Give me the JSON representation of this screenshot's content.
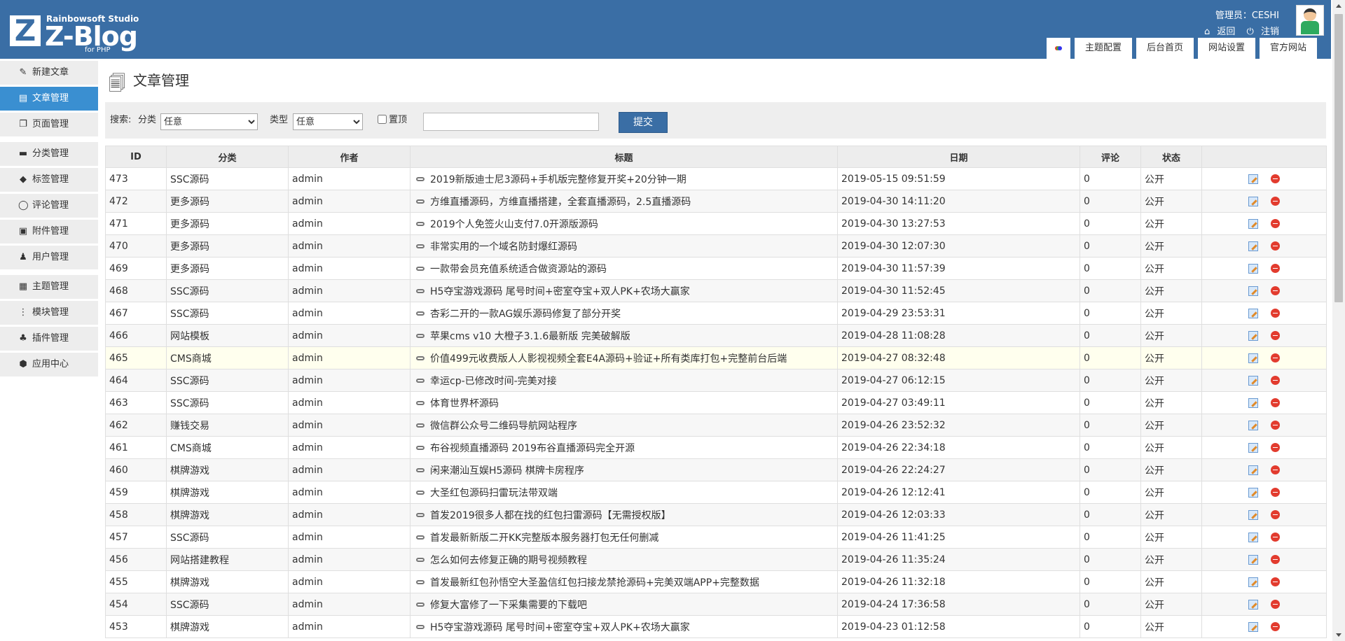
{
  "header": {
    "logo_studio": "Rainbowsoft Studio",
    "logo_name": "Z-Blog",
    "logo_sub": "for PHP",
    "admin_label": "管理员：CESHI",
    "back_link": "返回",
    "logout_link": "注销",
    "tabs": [
      "主题配置",
      "后台首页",
      "网站设置",
      "官方网站"
    ]
  },
  "sidebar": {
    "items": [
      {
        "label": "新建文章",
        "icon": "pencil-icon"
      },
      {
        "label": "文章管理",
        "icon": "document-icon"
      },
      {
        "label": "页面管理",
        "icon": "pages-icon"
      },
      {
        "label": "分类管理",
        "icon": "folder-icon"
      },
      {
        "label": "标签管理",
        "icon": "tag-icon"
      },
      {
        "label": "评论管理",
        "icon": "comment-icon"
      },
      {
        "label": "附件管理",
        "icon": "attachment-icon"
      },
      {
        "label": "用户管理",
        "icon": "user-icon"
      },
      {
        "label": "主题管理",
        "icon": "theme-icon"
      },
      {
        "label": "模块管理",
        "icon": "module-icon"
      },
      {
        "label": "插件管理",
        "icon": "plugin-icon"
      },
      {
        "label": "应用中心",
        "icon": "app-center-icon"
      }
    ]
  },
  "page": {
    "title": "文章管理"
  },
  "search": {
    "label": "搜索:",
    "category_label": "分类",
    "category_value": "任意",
    "type_label": "类型",
    "type_value": "任意",
    "top_label": "置顶",
    "keyword": "",
    "submit": "提交"
  },
  "table": {
    "headers": [
      "ID",
      "分类",
      "作者",
      "标题",
      "日期",
      "评论",
      "状态",
      ""
    ],
    "rows": [
      [
        "473",
        "SSC源码",
        "admin",
        "2019新版迪士尼3源码+手机版完整修复开奖+20分钟一期",
        "2019-05-15 09:51:59",
        "0",
        "公开"
      ],
      [
        "472",
        "更多源码",
        "admin",
        "方维直播源码，方维直播搭建，全套直播源码，2.5直播源码",
        "2019-04-30 14:11:20",
        "0",
        "公开"
      ],
      [
        "471",
        "更多源码",
        "admin",
        "2019个人免签火山支付7.0开源版源码",
        "2019-04-30 13:27:53",
        "0",
        "公开"
      ],
      [
        "470",
        "更多源码",
        "admin",
        "非常实用的一个域名防封爆红源码",
        "2019-04-30 12:07:30",
        "0",
        "公开"
      ],
      [
        "469",
        "更多源码",
        "admin",
        "一款带会员充值系统适合做资源站的源码",
        "2019-04-30 11:57:39",
        "0",
        "公开"
      ],
      [
        "468",
        "SSC源码",
        "admin",
        "H5夺宝游戏源码 尾号时间+密室夺宝+双人PK+农场大赢家",
        "2019-04-30 11:52:45",
        "0",
        "公开"
      ],
      [
        "467",
        "SSC源码",
        "admin",
        "杏彩二开的一款AG娱乐源码修复了部分开奖",
        "2019-04-29 23:53:31",
        "0",
        "公开"
      ],
      [
        "466",
        "网站模板",
        "admin",
        "苹果cms v10 大橙子3.1.6最新版 完美破解版",
        "2019-04-28 11:08:28",
        "0",
        "公开"
      ],
      [
        "465",
        "CMS商城",
        "admin",
        "价值499元收费版人人影视视频全套E4A源码+验证+所有类库打包+完整前台后端",
        "2019-04-27 08:32:48",
        "0",
        "公开"
      ],
      [
        "464",
        "SSC源码",
        "admin",
        "幸运cp-已修改时间-完美对接",
        "2019-04-27 06:12:15",
        "0",
        "公开"
      ],
      [
        "463",
        "SSC源码",
        "admin",
        "体育世界杯源码",
        "2019-04-27 03:49:11",
        "0",
        "公开"
      ],
      [
        "462",
        "赚钱交易",
        "admin",
        "微信群公众号二维码导航网站程序",
        "2019-04-26 23:52:32",
        "0",
        "公开"
      ],
      [
        "461",
        "CMS商城",
        "admin",
        "布谷视频直播源码 2019布谷直播源码完全开源",
        "2019-04-26 22:34:18",
        "0",
        "公开"
      ],
      [
        "460",
        "棋牌游戏",
        "admin",
        "闲来潮汕互娱H5源码 棋牌卡房程序",
        "2019-04-26 22:24:27",
        "0",
        "公开"
      ],
      [
        "459",
        "棋牌游戏",
        "admin",
        "大圣红包源码扫雷玩法带双端",
        "2019-04-26 12:12:41",
        "0",
        "公开"
      ],
      [
        "458",
        "棋牌游戏",
        "admin",
        "首发2019很多人都在找的红包扫雷源码【无需授权版】",
        "2019-04-26 12:03:33",
        "0",
        "公开"
      ],
      [
        "457",
        "SSC源码",
        "admin",
        "首发最新新版二开KK完整版本服务器打包无任何删减",
        "2019-04-26 11:41:25",
        "0",
        "公开"
      ],
      [
        "456",
        "网站搭建教程",
        "admin",
        "怎么如何去修复正确的期号视频教程",
        "2019-04-26 11:35:24",
        "0",
        "公开"
      ],
      [
        "455",
        "棋牌游戏",
        "admin",
        "首发最新红包孙悟空大圣盈信红包扫接龙禁抢源码+完美双端APP+完整数据",
        "2019-04-26 11:32:18",
        "0",
        "公开"
      ],
      [
        "454",
        "SSC源码",
        "admin",
        "修复大富修了一下采集需要的下载吧",
        "2019-04-24 17:36:58",
        "0",
        "公开"
      ],
      [
        "453",
        "棋牌游戏",
        "admin",
        "H5夺宝游戏源码 尾号时间+密室夺宝+双人PK+农场大赢家",
        "2019-04-23 01:12:58",
        "0",
        "公开"
      ]
    ],
    "highlighted_row_id": "465"
  },
  "colors": {
    "header_bg": "#3a6ea5",
    "sidebar_active": "#3a8fd1",
    "highlight_row": "#ffffee"
  }
}
